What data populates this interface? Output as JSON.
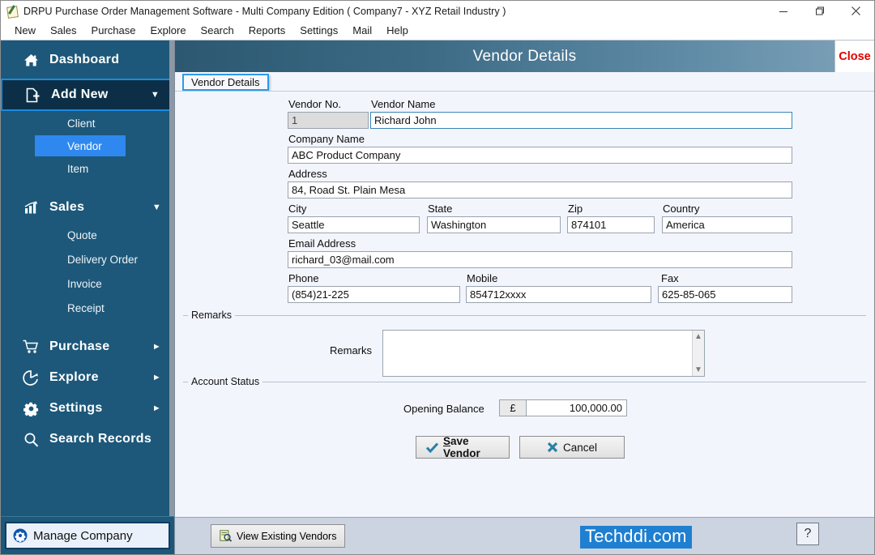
{
  "window": {
    "title": "DRPU Purchase Order Management Software - Multi Company Edition ( Company7 - XYZ Retail Industry )",
    "icon": "app-notepad-pencil-icon",
    "minimize": "minimize-icon",
    "maximize": "maximize-icon",
    "close": "close-icon"
  },
  "menubar": {
    "items": [
      {
        "label": "New"
      },
      {
        "label": "Sales"
      },
      {
        "label": "Purchase"
      },
      {
        "label": "Explore"
      },
      {
        "label": "Search"
      },
      {
        "label": "Reports"
      },
      {
        "label": "Settings"
      },
      {
        "label": "Mail"
      },
      {
        "label": "Help"
      }
    ]
  },
  "sidebar": {
    "dashboard": {
      "label": "Dashboard",
      "icon": "home-icon"
    },
    "add_new": {
      "label": "Add New",
      "icon": "file-plus-icon",
      "caret": "▼"
    },
    "add_new_children": [
      {
        "label": "Client",
        "selected": false
      },
      {
        "label": "Vendor",
        "selected": true
      },
      {
        "label": "Item",
        "selected": false
      }
    ],
    "sales": {
      "label": "Sales",
      "icon": "bar-chart-icon",
      "caret": "▼"
    },
    "sales_children": [
      {
        "label": "Quote"
      },
      {
        "label": "Delivery Order"
      },
      {
        "label": "Invoice"
      },
      {
        "label": "Receipt"
      }
    ],
    "purchase": {
      "label": "Purchase",
      "icon": "cart-icon",
      "caret": "►"
    },
    "explore": {
      "label": "Explore",
      "icon": "pie-chart-icon",
      "caret": "►"
    },
    "settings": {
      "label": "Settings",
      "icon": "gear-icon",
      "caret": "►"
    },
    "search_records": {
      "label": "Search Records",
      "icon": "magnifier-icon"
    },
    "manage_company": {
      "label": "Manage Company",
      "icon": "gear-circle-icon"
    }
  },
  "panel": {
    "title": "Vendor Details",
    "close_label": "Close",
    "tab_label": "Vendor Details"
  },
  "form": {
    "vendor_no": {
      "label": "Vendor No.",
      "value": "1"
    },
    "vendor_name": {
      "label": "Vendor Name",
      "value": "Richard John"
    },
    "company_name": {
      "label": "Company Name",
      "value": "ABC Product Company"
    },
    "address": {
      "label": "Address",
      "value": "84, Road St. Plain Mesa"
    },
    "city": {
      "label": "City",
      "value": "Seattle"
    },
    "state": {
      "label": "State",
      "value": "Washington"
    },
    "zip": {
      "label": "Zip",
      "value": "874101"
    },
    "country": {
      "label": "Country",
      "value": "America"
    },
    "email": {
      "label": "Email Address",
      "value": "richard_03@mail.com"
    },
    "phone": {
      "label": "Phone",
      "value": "(854)21-225"
    },
    "mobile": {
      "label": "Mobile",
      "value": "854712xxxx"
    },
    "fax": {
      "label": "Fax",
      "value": "625-85-065"
    }
  },
  "remarks": {
    "group_title": "Remarks",
    "field_label": "Remarks",
    "value": ""
  },
  "account_status": {
    "group_title": "Account Status",
    "opening_balance_label": "Opening Balance",
    "currency_symbol": "£",
    "opening_balance_value": "100,000.00"
  },
  "actions": {
    "save_prefix": "S",
    "save_rest": "ave Vendor",
    "save_icon": "check-icon",
    "cancel_label": "Cancel",
    "cancel_icon": "x-icon"
  },
  "statusbar": {
    "view_existing_label": "View Existing Vendors",
    "view_existing_icon": "list-search-icon",
    "watermark": "Techddi.com",
    "help_label": "?"
  },
  "colors": {
    "sidebar": "#1d587a",
    "sidebar_selected": "#2f88ef",
    "add_new_bg": "#0c2f47",
    "add_new_border": "#1b8ae0",
    "header_gradient_start": "#2c5871",
    "header_gradient_end": "#7fa3ba",
    "close_red": "#e00000",
    "watermark_blue": "#1f7fd0",
    "content_bg": "#f3f5fd",
    "statusbar_bg": "#ccd3e1"
  }
}
